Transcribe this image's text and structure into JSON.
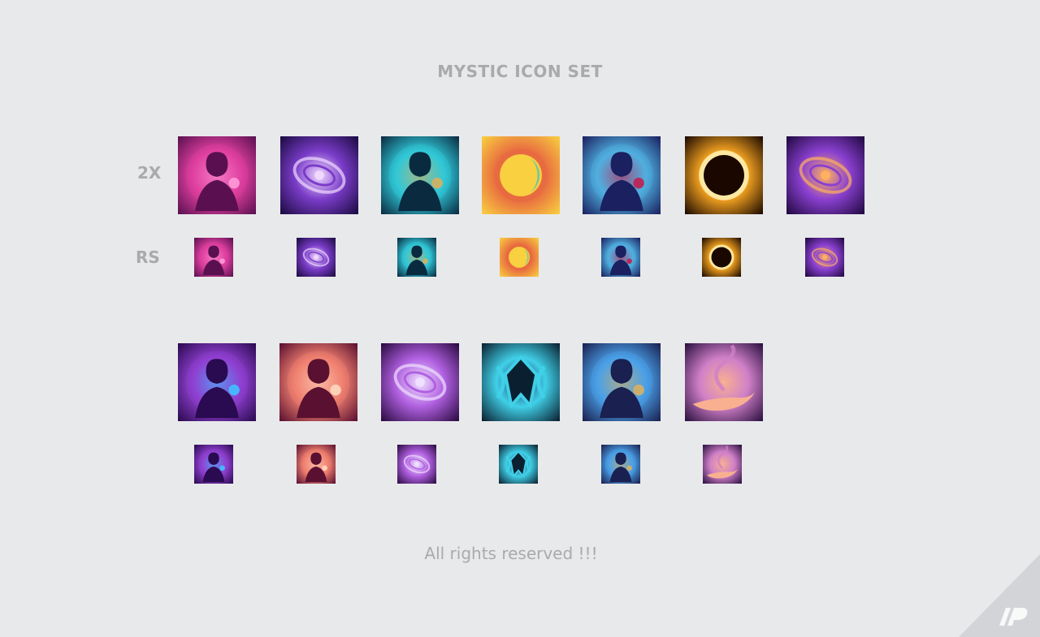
{
  "header": {
    "title": "MYSTIC ICON SET"
  },
  "rows": {
    "label_2x": "2X",
    "label_rs": "RS"
  },
  "icons_set_1": [
    {
      "name": "enchantress-portrait-icon",
      "colors": [
        "#e040a0",
        "#5a1050",
        "#ff9ad8"
      ]
    },
    {
      "name": "void-portal-light-icon",
      "colors": [
        "#7a3cc8",
        "#1a0a40",
        "#f0d8ff"
      ]
    },
    {
      "name": "cyan-mage-figure-icon",
      "colors": [
        "#30c8d8",
        "#0a2a40",
        "#d8b060"
      ]
    },
    {
      "name": "golden-moon-sun-icon",
      "colors": [
        "#e86a40",
        "#f8d040",
        "#70c8a0"
      ]
    },
    {
      "name": "hooded-summoner-circle-icon",
      "colors": [
        "#50b0e0",
        "#1a2060",
        "#c02050"
      ]
    },
    {
      "name": "solar-eclipse-icon",
      "colors": [
        "#f0a020",
        "#1a0800",
        "#fff0b0"
      ]
    },
    {
      "name": "spiral-galaxy-icon",
      "colors": [
        "#8a40d0",
        "#200840",
        "#ffb060"
      ]
    }
  ],
  "icons_set_2": [
    {
      "name": "sorceress-orb-icon",
      "colors": [
        "#9040d0",
        "#2a0a50",
        "#40c0ff"
      ]
    },
    {
      "name": "dancer-flame-icon",
      "colors": [
        "#f08070",
        "#5a1030",
        "#ffd8c0"
      ]
    },
    {
      "name": "whirlwind-sorceress-icon",
      "colors": [
        "#b060e0",
        "#2a0a40",
        "#f0e0ff"
      ]
    },
    {
      "name": "arcane-sigil-icon",
      "colors": [
        "#40d0e8",
        "#0a2030",
        "#203060"
      ]
    },
    {
      "name": "staff-wielder-mage-icon",
      "colors": [
        "#4aa0e8",
        "#1a2050",
        "#d8b060"
      ]
    },
    {
      "name": "spirit-hand-icon",
      "colors": [
        "#d080c8",
        "#2a1040",
        "#f8b090"
      ]
    }
  ],
  "footer": {
    "text": "All rights reserved !!!"
  },
  "brand": {
    "logo": "logo-mark",
    "color": "#d2d4d7"
  }
}
